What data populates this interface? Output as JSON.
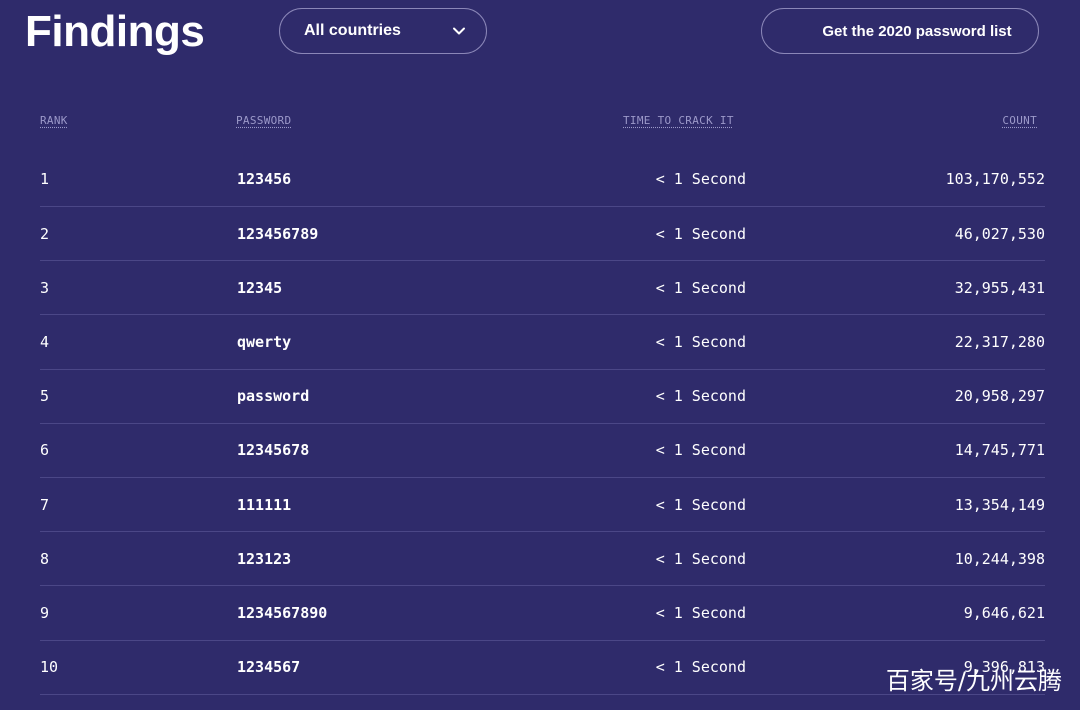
{
  "header": {
    "title": "Findings",
    "country_select": "All countries",
    "download_label": "Get the 2020 password list"
  },
  "table": {
    "columns": {
      "rank": "RANK",
      "password": "PASSWORD",
      "time": "TIME TO CRACK IT",
      "count": "COUNT"
    },
    "rows": [
      {
        "rank": "1",
        "password": "123456",
        "time": "< 1 Second",
        "count": "103,170,552"
      },
      {
        "rank": "2",
        "password": "123456789",
        "time": "< 1 Second",
        "count": "46,027,530"
      },
      {
        "rank": "3",
        "password": "12345",
        "time": "< 1 Second",
        "count": "32,955,431"
      },
      {
        "rank": "4",
        "password": "qwerty",
        "time": "< 1 Second",
        "count": "22,317,280"
      },
      {
        "rank": "5",
        "password": "password",
        "time": "< 1 Second",
        "count": "20,958,297"
      },
      {
        "rank": "6",
        "password": "12345678",
        "time": "< 1 Second",
        "count": "14,745,771"
      },
      {
        "rank": "7",
        "password": "111111",
        "time": "< 1 Second",
        "count": "13,354,149"
      },
      {
        "rank": "8",
        "password": "123123",
        "time": "< 1 Second",
        "count": "10,244,398"
      },
      {
        "rank": "9",
        "password": "1234567890",
        "time": "< 1 Second",
        "count": "9,646,621"
      },
      {
        "rank": "10",
        "password": "1234567",
        "time": "< 1 Second",
        "count": "9,396,813"
      }
    ]
  },
  "watermark": "百家号/九州云腾",
  "colors": {
    "background": "#2f2b6b",
    "border": "#8b87b8",
    "row_divider": "#4b4787",
    "header_text": "#9c99c9"
  },
  "icons": {
    "dropdown": "chevron-down-icon"
  }
}
